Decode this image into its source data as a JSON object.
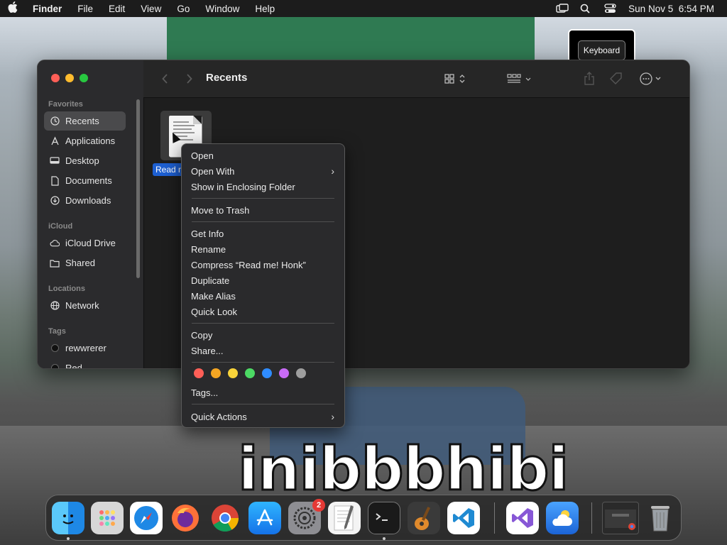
{
  "menubar": {
    "apple": "",
    "app_name": "Finder",
    "menus": [
      "File",
      "Edit",
      "View",
      "Go",
      "Window",
      "Help"
    ],
    "datetime": "Sun Nov 5  6:54 PM"
  },
  "tooltip": {
    "label": "Keyboard"
  },
  "finder": {
    "title": "Recents",
    "sidebar": {
      "favorites_header": "Favorites",
      "favorites": [
        {
          "label": "Recents",
          "icon": "clock-icon"
        },
        {
          "label": "Applications",
          "icon": "applications-icon"
        },
        {
          "label": "Desktop",
          "icon": "desktop-icon"
        },
        {
          "label": "Documents",
          "icon": "document-icon"
        },
        {
          "label": "Downloads",
          "icon": "download-icon"
        }
      ],
      "icloud_header": "iCloud",
      "icloud": [
        {
          "label": "iCloud Drive",
          "icon": "cloud-icon"
        },
        {
          "label": "Shared",
          "icon": "shared-folder-icon"
        }
      ],
      "locations_header": "Locations",
      "locations": [
        {
          "label": "Network",
          "icon": "globe-icon"
        }
      ],
      "tags_header": "Tags",
      "tags": [
        {
          "label": "rewwrerer",
          "color": "#1a1a1a"
        },
        {
          "label": "Red",
          "color": "#1a1a1a"
        }
      ]
    },
    "file": {
      "label": "Read me! Honk"
    }
  },
  "context_menu": {
    "open": "Open",
    "open_with": "Open With",
    "show_enclosing": "Show in Enclosing Folder",
    "move_to_trash": "Move to Trash",
    "get_info": "Get Info",
    "rename": "Rename",
    "compress": "Compress “Read me! Honk”",
    "duplicate": "Duplicate",
    "make_alias": "Make Alias",
    "quick_look": "Quick Look",
    "copy": "Copy",
    "share": "Share...",
    "tags": "Tags...",
    "quick_actions": "Quick Actions",
    "tag_colors": [
      "#ff5f57",
      "#f5a623",
      "#f8d33a",
      "#4cd964",
      "#2f8cff",
      "#c86bf5",
      "#9e9e9e"
    ]
  },
  "dock": {
    "settings_badge": "2"
  },
  "colors": {
    "accent": "#1d5fd1",
    "close": "#ff5f57",
    "minimize": "#febc2e",
    "zoom": "#28c840"
  }
}
